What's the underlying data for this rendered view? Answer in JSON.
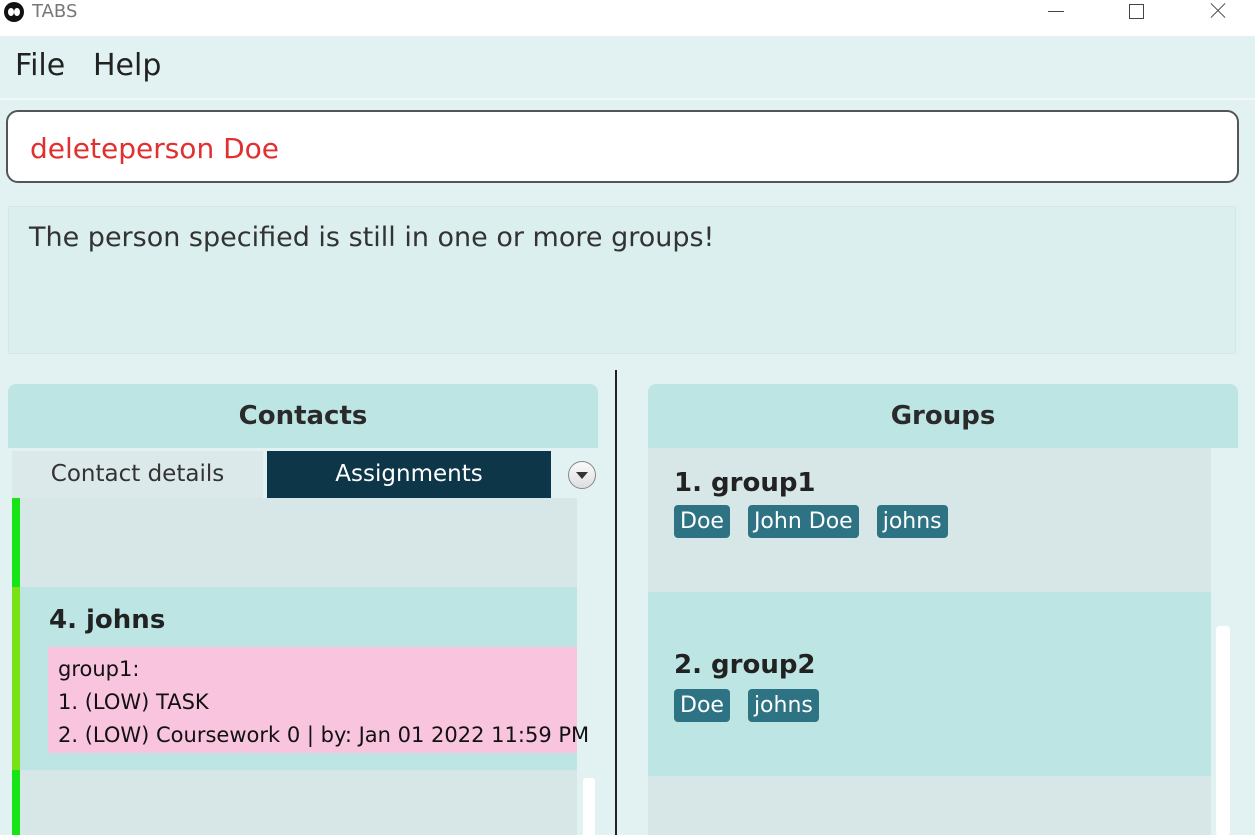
{
  "window": {
    "title": "TABS"
  },
  "menu": {
    "file": "File",
    "help": "Help"
  },
  "command": {
    "value": "deleteperson Doe"
  },
  "result": {
    "text": "The person specified is still in one or more groups!"
  },
  "contacts": {
    "header": "Contacts",
    "tabs": [
      {
        "label": "Contact details",
        "selected": false
      },
      {
        "label": "Assignments",
        "selected": true
      }
    ],
    "cells": [
      {
        "name": "4.  johns",
        "assignment_group": "group1:",
        "assignments": [
          "1. (LOW) TASK",
          "2. (LOW) Coursework 0 | by: Jan 01 2022 11:59 PM"
        ]
      }
    ]
  },
  "groups": {
    "header": "Groups",
    "items": [
      {
        "name": "1.  group1",
        "members": [
          "Doe",
          "John Doe",
          "johns"
        ]
      },
      {
        "name": "2.  group2",
        "members": [
          "Doe",
          "johns"
        ]
      }
    ]
  },
  "colors": {
    "accent_dark": "#0d3748",
    "header_bg": "#bce5e3",
    "tag_bg": "#2d7383",
    "assignment_bg": "#f8c4de",
    "command_text": "#e03030",
    "stripe_green": "#16e416",
    "stripe_lime": "#7ae116"
  }
}
